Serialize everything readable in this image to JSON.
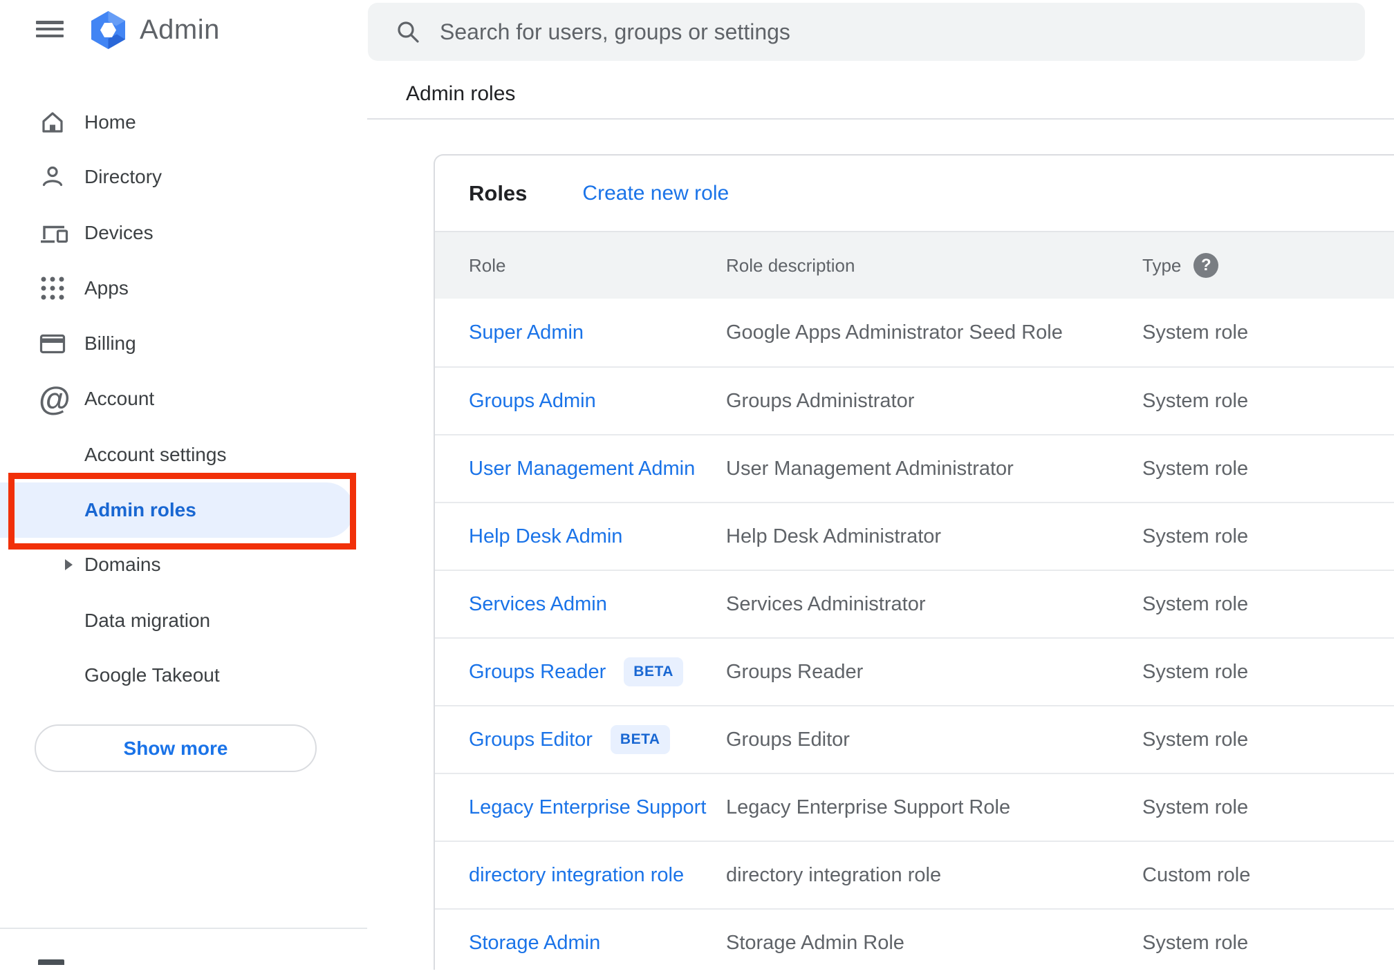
{
  "app": {
    "title": "Admin"
  },
  "search": {
    "placeholder": "Search for users, groups or settings"
  },
  "breadcrumb": "Admin roles",
  "sidebar": {
    "items": [
      {
        "label": "Home",
        "icon": "home",
        "arrow": null,
        "indent": false,
        "selected": false
      },
      {
        "label": "Directory",
        "icon": "person",
        "arrow": "right",
        "indent": false,
        "selected": false
      },
      {
        "label": "Devices",
        "icon": "devices",
        "arrow": "right",
        "indent": false,
        "selected": false
      },
      {
        "label": "Apps",
        "icon": "apps-grid",
        "arrow": "right",
        "indent": false,
        "selected": false
      },
      {
        "label": "Billing",
        "icon": "credit-card",
        "arrow": "right",
        "indent": false,
        "selected": false
      },
      {
        "label": "Account",
        "icon": "at-sign",
        "arrow": "down",
        "indent": false,
        "selected": false
      },
      {
        "label": "Account settings",
        "icon": null,
        "arrow": null,
        "indent": true,
        "selected": false
      },
      {
        "label": "Admin roles",
        "icon": null,
        "arrow": null,
        "indent": true,
        "selected": true
      },
      {
        "label": "Domains",
        "icon": null,
        "arrow": "right",
        "indent": true,
        "selected": false
      },
      {
        "label": "Data migration",
        "icon": null,
        "arrow": null,
        "indent": true,
        "selected": false
      },
      {
        "label": "Google Takeout",
        "icon": null,
        "arrow": null,
        "indent": true,
        "selected": false
      }
    ],
    "show_more_label": "Show more"
  },
  "roles_card": {
    "title": "Roles",
    "create_new_role_label": "Create new role",
    "columns": [
      "Role",
      "Role description",
      "Type"
    ],
    "beta_badge_label": "BETA",
    "rows": [
      {
        "role": "Super Admin",
        "beta": false,
        "description": "Google Apps Administrator Seed Role",
        "type": "System role"
      },
      {
        "role": "Groups Admin",
        "beta": false,
        "description": "Groups Administrator",
        "type": "System role"
      },
      {
        "role": "User Management Admin",
        "beta": false,
        "description": "User Management Administrator",
        "type": "System role"
      },
      {
        "role": "Help Desk Admin",
        "beta": false,
        "description": "Help Desk Administrator",
        "type": "System role"
      },
      {
        "role": "Services Admin",
        "beta": false,
        "description": "Services Administrator",
        "type": "System role"
      },
      {
        "role": "Groups Reader",
        "beta": true,
        "description": "Groups Reader",
        "type": "System role"
      },
      {
        "role": "Groups Editor",
        "beta": true,
        "description": "Groups Editor",
        "type": "System role"
      },
      {
        "role": "Legacy Enterprise Support",
        "beta": false,
        "description": "Legacy Enterprise Support Role",
        "type": "System role"
      },
      {
        "role": "directory integration role",
        "beta": false,
        "description": "directory integration role",
        "type": "Custom role"
      },
      {
        "role": "Storage Admin",
        "beta": false,
        "description": "Storage Admin Role",
        "type": "System role"
      }
    ]
  },
  "annotation": {
    "shape": "red-box",
    "target": "Admin roles sidebar item",
    "color": "#f13009"
  },
  "colors": {
    "accent_blue": "#1a73e8",
    "selected_blue": "#1967d2",
    "selected_bg": "#e8f0fe",
    "badge_bg": "#e8f0fe",
    "badge_text": "#1967d2",
    "annotation_red": "#f13009",
    "header_band_bg": "#f1f3f4",
    "search_bg": "#f1f3f4",
    "divider": "#e0e0e0",
    "text_dark": "#202124",
    "text_gray": "#5f6368",
    "logo_blue": "#4285f4"
  }
}
